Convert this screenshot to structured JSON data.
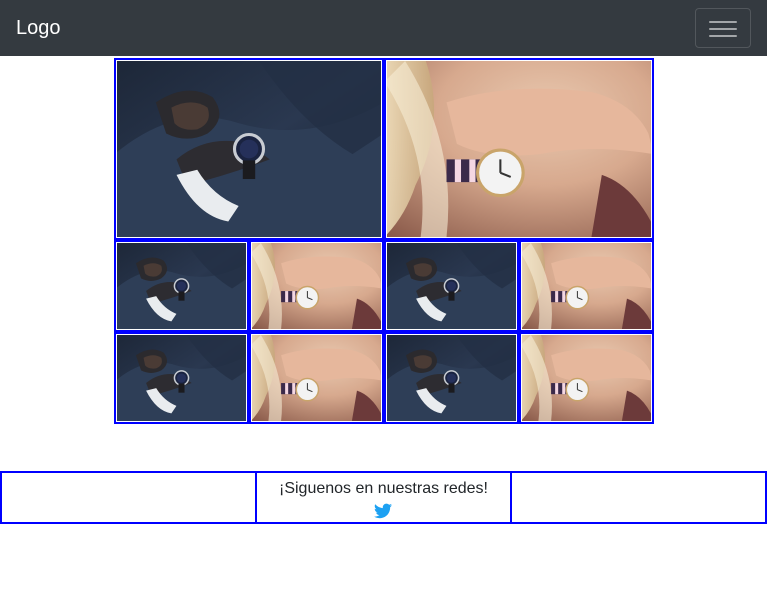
{
  "navbar": {
    "brand": "Logo",
    "toggler_icon": "hamburger-menu-icon",
    "background": "#343a40"
  },
  "gallery": {
    "border_color": "#0000ff",
    "rows": [
      [
        "man-suit-watch",
        "woman-wrist-watch"
      ],
      [
        "man-suit-watch",
        "woman-wrist-watch",
        "man-suit-watch",
        "woman-wrist-watch"
      ],
      [
        "man-suit-watch",
        "woman-wrist-watch",
        "man-suit-watch",
        "woman-wrist-watch"
      ]
    ]
  },
  "footer": {
    "follow_text": "¡Siguenos en nuestras redes!",
    "social_icon": "twitter-icon",
    "social_color": "#1da1f2"
  }
}
